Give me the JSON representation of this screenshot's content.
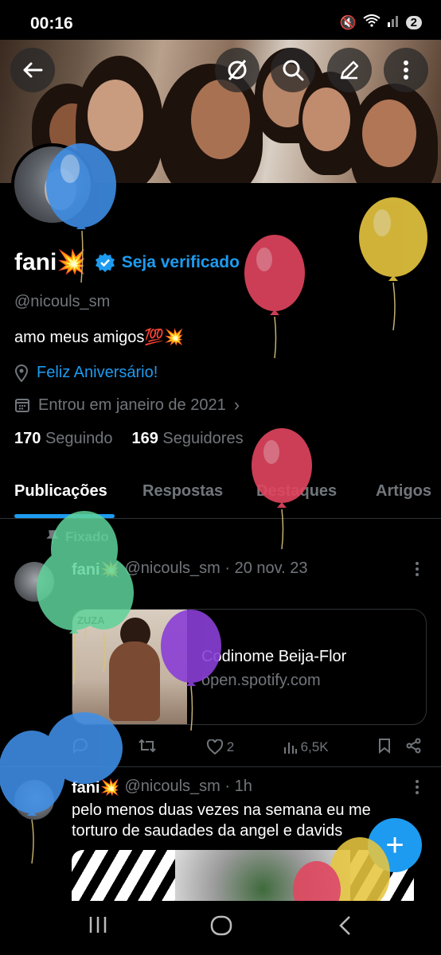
{
  "status_bar": {
    "time": "00:16",
    "notification_count": "2"
  },
  "profile": {
    "name": "fani💥",
    "verify_label": "Seja verificado",
    "handle": "@nicouls_sm",
    "bio": "amo meus amigos💯💥",
    "location": "Feliz Aniversário!",
    "joined": "Entrou em janeiro de 2021",
    "following_count": "170",
    "following_label": "Seguindo",
    "followers_count": "169",
    "followers_label": "Seguidores"
  },
  "tabs": [
    "Publicações",
    "Respostas",
    "Destaques",
    "Artigos"
  ],
  "pinned_label": "Fixado",
  "post1": {
    "name": "fani💥",
    "handle_date": "@nicouls_sm · 20 nov. 23",
    "card_title": "Codinome Beija-Flor",
    "card_url": "open.spotify.com",
    "likes": "2",
    "views": "6,5K",
    "album_text": "ZUZA"
  },
  "post2": {
    "name": "fani💥",
    "handle_time": "@nicouls_sm · 1h",
    "text": "pelo menos duas vezes na semana eu me torturo de saudades da angel e davids"
  },
  "colors": {
    "accent": "#1d9bf0",
    "background": "#000000",
    "muted": "#71767b"
  },
  "icons": [
    "back-arrow-icon",
    "hide-icon",
    "search-icon",
    "edit-icon",
    "more-vert-icon",
    "verified-badge-icon",
    "location-pin-icon",
    "calendar-icon",
    "pin-icon",
    "reply-icon",
    "retweet-icon",
    "like-icon",
    "views-icon",
    "bookmark-icon",
    "share-icon",
    "compose-icon"
  ]
}
